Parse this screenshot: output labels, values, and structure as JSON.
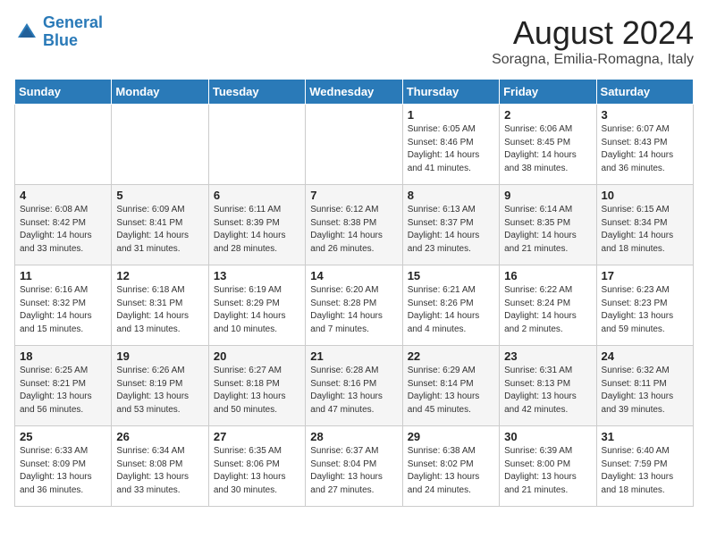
{
  "header": {
    "logo_line1": "General",
    "logo_line2": "Blue",
    "month_title": "August 2024",
    "location": "Soragna, Emilia-Romagna, Italy"
  },
  "weekdays": [
    "Sunday",
    "Monday",
    "Tuesday",
    "Wednesday",
    "Thursday",
    "Friday",
    "Saturday"
  ],
  "weeks": [
    [
      {
        "day": "",
        "info": ""
      },
      {
        "day": "",
        "info": ""
      },
      {
        "day": "",
        "info": ""
      },
      {
        "day": "",
        "info": ""
      },
      {
        "day": "1",
        "info": "Sunrise: 6:05 AM\nSunset: 8:46 PM\nDaylight: 14 hours\nand 41 minutes."
      },
      {
        "day": "2",
        "info": "Sunrise: 6:06 AM\nSunset: 8:45 PM\nDaylight: 14 hours\nand 38 minutes."
      },
      {
        "day": "3",
        "info": "Sunrise: 6:07 AM\nSunset: 8:43 PM\nDaylight: 14 hours\nand 36 minutes."
      }
    ],
    [
      {
        "day": "4",
        "info": "Sunrise: 6:08 AM\nSunset: 8:42 PM\nDaylight: 14 hours\nand 33 minutes."
      },
      {
        "day": "5",
        "info": "Sunrise: 6:09 AM\nSunset: 8:41 PM\nDaylight: 14 hours\nand 31 minutes."
      },
      {
        "day": "6",
        "info": "Sunrise: 6:11 AM\nSunset: 8:39 PM\nDaylight: 14 hours\nand 28 minutes."
      },
      {
        "day": "7",
        "info": "Sunrise: 6:12 AM\nSunset: 8:38 PM\nDaylight: 14 hours\nand 26 minutes."
      },
      {
        "day": "8",
        "info": "Sunrise: 6:13 AM\nSunset: 8:37 PM\nDaylight: 14 hours\nand 23 minutes."
      },
      {
        "day": "9",
        "info": "Sunrise: 6:14 AM\nSunset: 8:35 PM\nDaylight: 14 hours\nand 21 minutes."
      },
      {
        "day": "10",
        "info": "Sunrise: 6:15 AM\nSunset: 8:34 PM\nDaylight: 14 hours\nand 18 minutes."
      }
    ],
    [
      {
        "day": "11",
        "info": "Sunrise: 6:16 AM\nSunset: 8:32 PM\nDaylight: 14 hours\nand 15 minutes."
      },
      {
        "day": "12",
        "info": "Sunrise: 6:18 AM\nSunset: 8:31 PM\nDaylight: 14 hours\nand 13 minutes."
      },
      {
        "day": "13",
        "info": "Sunrise: 6:19 AM\nSunset: 8:29 PM\nDaylight: 14 hours\nand 10 minutes."
      },
      {
        "day": "14",
        "info": "Sunrise: 6:20 AM\nSunset: 8:28 PM\nDaylight: 14 hours\nand 7 minutes."
      },
      {
        "day": "15",
        "info": "Sunrise: 6:21 AM\nSunset: 8:26 PM\nDaylight: 14 hours\nand 4 minutes."
      },
      {
        "day": "16",
        "info": "Sunrise: 6:22 AM\nSunset: 8:24 PM\nDaylight: 14 hours\nand 2 minutes."
      },
      {
        "day": "17",
        "info": "Sunrise: 6:23 AM\nSunset: 8:23 PM\nDaylight: 13 hours\nand 59 minutes."
      }
    ],
    [
      {
        "day": "18",
        "info": "Sunrise: 6:25 AM\nSunset: 8:21 PM\nDaylight: 13 hours\nand 56 minutes."
      },
      {
        "day": "19",
        "info": "Sunrise: 6:26 AM\nSunset: 8:19 PM\nDaylight: 13 hours\nand 53 minutes."
      },
      {
        "day": "20",
        "info": "Sunrise: 6:27 AM\nSunset: 8:18 PM\nDaylight: 13 hours\nand 50 minutes."
      },
      {
        "day": "21",
        "info": "Sunrise: 6:28 AM\nSunset: 8:16 PM\nDaylight: 13 hours\nand 47 minutes."
      },
      {
        "day": "22",
        "info": "Sunrise: 6:29 AM\nSunset: 8:14 PM\nDaylight: 13 hours\nand 45 minutes."
      },
      {
        "day": "23",
        "info": "Sunrise: 6:31 AM\nSunset: 8:13 PM\nDaylight: 13 hours\nand 42 minutes."
      },
      {
        "day": "24",
        "info": "Sunrise: 6:32 AM\nSunset: 8:11 PM\nDaylight: 13 hours\nand 39 minutes."
      }
    ],
    [
      {
        "day": "25",
        "info": "Sunrise: 6:33 AM\nSunset: 8:09 PM\nDaylight: 13 hours\nand 36 minutes."
      },
      {
        "day": "26",
        "info": "Sunrise: 6:34 AM\nSunset: 8:08 PM\nDaylight: 13 hours\nand 33 minutes."
      },
      {
        "day": "27",
        "info": "Sunrise: 6:35 AM\nSunset: 8:06 PM\nDaylight: 13 hours\nand 30 minutes."
      },
      {
        "day": "28",
        "info": "Sunrise: 6:37 AM\nSunset: 8:04 PM\nDaylight: 13 hours\nand 27 minutes."
      },
      {
        "day": "29",
        "info": "Sunrise: 6:38 AM\nSunset: 8:02 PM\nDaylight: 13 hours\nand 24 minutes."
      },
      {
        "day": "30",
        "info": "Sunrise: 6:39 AM\nSunset: 8:00 PM\nDaylight: 13 hours\nand 21 minutes."
      },
      {
        "day": "31",
        "info": "Sunrise: 6:40 AM\nSunset: 7:59 PM\nDaylight: 13 hours\nand 18 minutes."
      }
    ]
  ]
}
